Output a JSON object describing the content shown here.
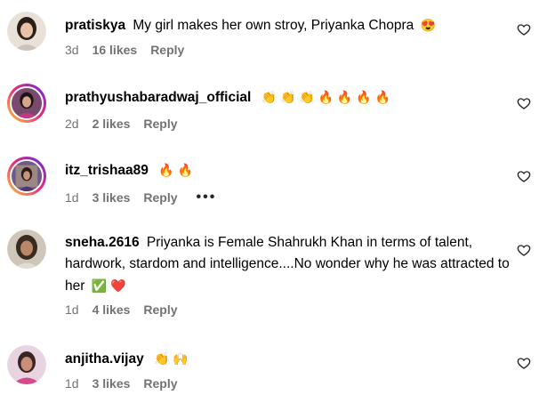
{
  "comments": [
    {
      "username": "pratiskya",
      "text": "My girl makes her own stroy, Priyanka Chopra",
      "emojis": "😍",
      "time": "3d",
      "likes": "16 likes",
      "reply": "Reply",
      "story_ring": false
    },
    {
      "username": "prathyushabaradwaj_official",
      "text": "",
      "emojis": "👏 👏 👏 🔥 🔥 🔥 🔥",
      "time": "2d",
      "likes": "2 likes",
      "reply": "Reply",
      "story_ring": true
    },
    {
      "username": "itz_trishaa89",
      "text": "",
      "emojis": "🔥 🔥",
      "time": "1d",
      "likes": "3 likes",
      "reply": "Reply",
      "more": "•••",
      "story_ring": true
    },
    {
      "username": "sneha.2616",
      "text": "Priyanka is Female Shahrukh Khan in terms of talent, hardwork, stardom and intelligence....No wonder why he was attracted to her",
      "emojis": "✅ ❤️",
      "time": "1d",
      "likes": "4 likes",
      "reply": "Reply",
      "story_ring": false
    },
    {
      "username": "anjitha.vijay",
      "text": "",
      "emojis": "👏 🙌",
      "time": "1d",
      "likes": "3 likes",
      "reply": "Reply",
      "story_ring": false
    }
  ],
  "icons": {
    "like": "heart-outline-icon",
    "more": "more-options-icon"
  },
  "colors": {
    "meta_gray": "#737373",
    "ring_start": "#f9ce34",
    "ring_mid": "#ee2a7b",
    "ring_end": "#6228d7"
  }
}
